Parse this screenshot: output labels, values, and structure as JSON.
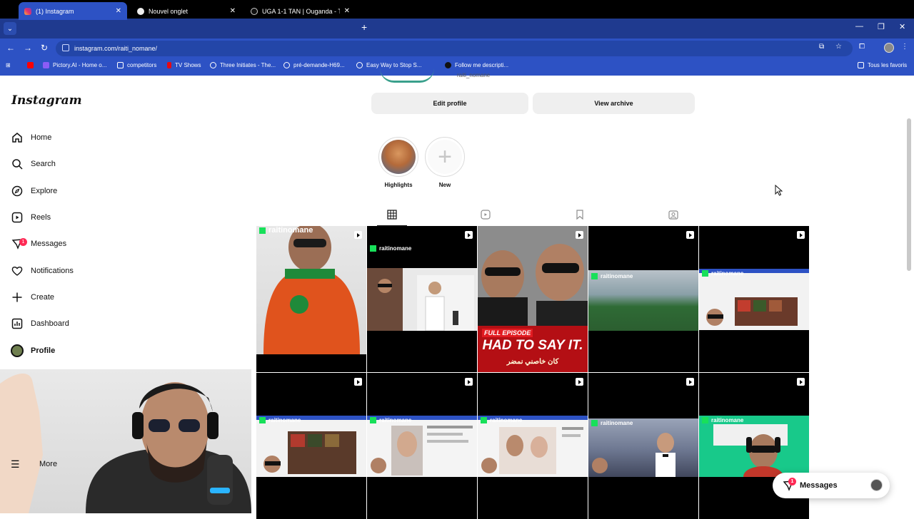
{
  "browser": {
    "tabs": [
      {
        "label": "(1) Instagram",
        "active": true
      },
      {
        "label": "Nouvel onglet",
        "active": false
      },
      {
        "label": "UGA 1-1 TAN | Ouganda - Tanz",
        "active": false
      }
    ],
    "url": "instagram.com/raiti_nomane/",
    "bookmarks": [
      {
        "label": "Pictory.AI - Home o..."
      },
      {
        "label": "competitors"
      },
      {
        "label": "TV Shows"
      },
      {
        "label": "Three Initiates - The..."
      },
      {
        "label": "pré-demande-H69..."
      },
      {
        "label": "Easy Way to Stop S..."
      },
      {
        "label": "Follow me descripti..."
      },
      {
        "label": "Tous les favoris"
      }
    ]
  },
  "instagram": {
    "logo": "Instagram",
    "nav": [
      {
        "label": "Home",
        "icon": "home-icon"
      },
      {
        "label": "Search",
        "icon": "search-icon"
      },
      {
        "label": "Explore",
        "icon": "compass-icon"
      },
      {
        "label": "Reels",
        "icon": "reels-icon"
      },
      {
        "label": "Messages",
        "icon": "messenger-icon",
        "badge": "1"
      },
      {
        "label": "Notifications",
        "icon": "heart-icon"
      },
      {
        "label": "Create",
        "icon": "plus-icon"
      },
      {
        "label": "Dashboard",
        "icon": "chart-icon"
      },
      {
        "label": "Profile",
        "icon": "avatar"
      }
    ],
    "more_label": "More",
    "profile": {
      "handle": "raiti_nomane",
      "edit_label": "Edit profile",
      "archive_label": "View archive"
    },
    "highlights": [
      {
        "label": "Highlights"
      },
      {
        "label": "New"
      }
    ],
    "grid": {
      "watermark": "raitinomane",
      "banner_top": "FULL EPISODE",
      "banner_main": "HAD TO SAY IT.",
      "banner_arabic": "كان خاصني نمضر"
    },
    "messages_pill": {
      "label": "Messages",
      "badge": "1"
    }
  },
  "colors": {
    "chrome_dark": "#1f3a8f",
    "chrome": "#2d52c4",
    "badge": "#ff2a55",
    "watermark_green": "#18e05a"
  }
}
